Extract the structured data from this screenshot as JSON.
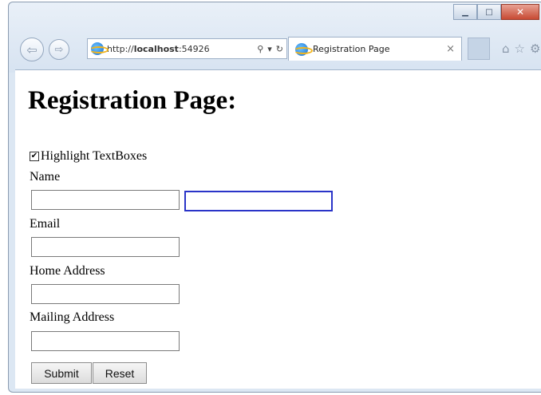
{
  "browser": {
    "address_url_prefix": "http://",
    "address_url_host": "localhost",
    "address_url_suffix": ":54926",
    "tab_title": "Registration Page",
    "tab_close": "×"
  },
  "page": {
    "title": "Registration Page:",
    "highlight_checkbox": {
      "label": "Highlight TextBoxes",
      "checked": true
    },
    "fields": [
      {
        "label": "Name",
        "value": ""
      },
      {
        "label": "Email",
        "value": ""
      },
      {
        "label": "Home Address",
        "value": ""
      },
      {
        "label": "Mailing Address",
        "value": ""
      }
    ],
    "name_extra_input_value": "",
    "submit_label": "Submit",
    "reset_label": "Reset"
  },
  "colors": {
    "focus_border": "#2a34c8"
  }
}
